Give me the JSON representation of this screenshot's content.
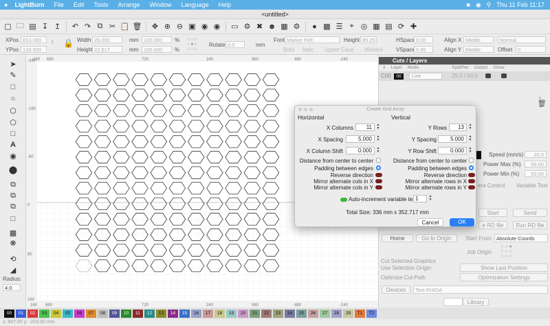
{
  "menubar": {
    "app": "LightBurn",
    "items": [
      "File",
      "Edit",
      "Tools",
      "Arrange",
      "Window",
      "Language",
      "Help"
    ],
    "clock": "Thu 11 Feb  11:17"
  },
  "window": {
    "title": "<untitled>"
  },
  "toolbar2": {
    "xpos_label": "XPos",
    "xpos_value": "813.000",
    "ypos_label": "YPos",
    "ypos_value": "133.000",
    "width_label": "Width",
    "width_value": "26.000",
    "height_label": "Height",
    "height_value": "22.517",
    "mm1": "mm",
    "mm2": "mm",
    "scale_w": "100.000",
    "scale_h": "100.000",
    "pct1": "%",
    "pct2": "%",
    "rotate_label": "Rotate",
    "rotate_value": "0.0",
    "rotate_unit": "mm",
    "font_label": "Font",
    "font_value": "Marker Felt",
    "fheight_label": "Height",
    "fheight_value": "85.25",
    "hspace_label": "HSpace",
    "hspace_value": "0.00",
    "vspace_label": "VSpace",
    "vspace_value": "0.00",
    "alignx_label": "Align X",
    "alignx_value": "Middle",
    "aligny_label": "Align Y",
    "aligny_value": "Middle",
    "normal_value": "Normal",
    "offset_label": "Offset",
    "offset_value": "0",
    "bold": "Bold",
    "italic": "Italic",
    "upper": "Upper Case",
    "welded": "Welded"
  },
  "ruler": {
    "top": [
      "-240",
      "680",
      "720",
      "240",
      "960",
      "480",
      "-240"
    ],
    "bottom": [
      "160",
      "680",
      "720",
      "240",
      "960",
      "480",
      "-240"
    ],
    "left": [
      "-240",
      "-160",
      "-80",
      "0",
      "80",
      "160"
    ]
  },
  "cuts_panel": {
    "title": "Cuts / Layers",
    "headers": [
      "#",
      "Layer",
      "Mode",
      "Spd/Pwr",
      "Output",
      "Show"
    ],
    "row": {
      "num": "C00",
      "layer": "00",
      "mode": "Line",
      "spd": "25.0 / 50.0"
    }
  },
  "right_panel": {
    "speed_label": "Speed (mm/s)",
    "speed_value": "35.0",
    "pmax_label": "Power Max (%)",
    "pmax_value": "50.00",
    "pmin_label": "Power Min (%)",
    "pmin_value": "50.00",
    "tab_camera": "era Control",
    "tab_variable": "Variable Text",
    "start_button": "Start",
    "send_button": "Send",
    "save_rd": "e RD file",
    "run_rd": "Run RD file",
    "home_button": "Home",
    "goto_origin": "Go to Origin",
    "start_from_label": "Start From",
    "start_from_value": "Absolute Coords",
    "job_origin": "Job Origin",
    "cut_selected": "Cut Selected Graphics",
    "use_selection": "Use Selection Origin",
    "optimize_cut": "Optimize Cut Path",
    "show_last": "Show Last Position",
    "opt_settings": "Optimization Settings",
    "devices": "Devices",
    "device_name": "Test RUIDA",
    "library": "Library"
  },
  "left_tools": {
    "radius_label": "Radius:",
    "radius_value": "4.0"
  },
  "dialog": {
    "title": "Create Grid Array",
    "horizontal": "Horizontal",
    "vertical": "Vertical",
    "x_columns_label": "X Columns",
    "x_columns": "11",
    "x_spacing_label": "X Spacing",
    "x_spacing": "5.000",
    "x_shift_label": "X Column Shift",
    "x_shift": "0.000",
    "y_rows_label": "Y Rows",
    "y_rows": "13",
    "y_spacing_label": "Y Spacing",
    "y_spacing": "5.000",
    "y_shift_label": "Y Row Shift",
    "y_shift": "0.000",
    "dist_center_h": "Distance from center to center",
    "padding_h": "Padding between edges",
    "reverse_h": "Reverse direction",
    "mirror_x_h": "Mirror alternate cols in X",
    "mirror_y_h": "Mirror alternate cols in Y",
    "dist_center_v": "Distance from center to center",
    "padding_v": "Padding between edges",
    "reverse_v": "Reverse direction",
    "mirror_x_v": "Mirror alternate rows in X",
    "mirror_y_v": "Mirror alternate rows in Y",
    "auto_increment": "Auto-increment variable text",
    "auto_value": "1",
    "total_size": "Total Size: 336 mm x 352.717 mm",
    "cancel": "Cancel",
    "ok": "OK"
  },
  "grid": {
    "cols": 11,
    "rows": 13
  },
  "palette": {
    "labels": [
      "00",
      "01",
      "02",
      "03",
      "04",
      "05",
      "06",
      "07",
      "08",
      "09",
      "10",
      "11",
      "12",
      "13",
      "14",
      "15",
      "16",
      "17",
      "18",
      "19",
      "20",
      "21",
      "22",
      "23",
      "24",
      "25",
      "26",
      "27",
      "28",
      "29",
      "T1",
      "T2"
    ],
    "colors": [
      "#111111",
      "#3b5bd6",
      "#d63b3b",
      "#4ec24e",
      "#c8c83b",
      "#3bb7c8",
      "#c83bc8",
      "#e08a2a",
      "#bdbdbd",
      "#555599",
      "#2a8a2a",
      "#8a2a2a",
      "#2a8a8a",
      "#8a8a2a",
      "#8a2a8a",
      "#3a70c8",
      "#9aa0c8",
      "#c89a9a",
      "#c8c88a",
      "#9ac8c8",
      "#c89ac8",
      "#7aa07a",
      "#a07a7a",
      "#a0a07a",
      "#7a7aa0",
      "#7aa0a0",
      "#c8a0a0",
      "#a0c8a0",
      "#a0a0c8",
      "#c8c8a0",
      "#e07a3a",
      "#6a8ae0"
    ]
  },
  "status": {
    "coords": "x: 847.00 y: -223.00 mm"
  },
  "colors": {
    "menubar": "#5ab0e6",
    "ok_button": "#2a7ff5",
    "selection": "#4a90d9"
  }
}
